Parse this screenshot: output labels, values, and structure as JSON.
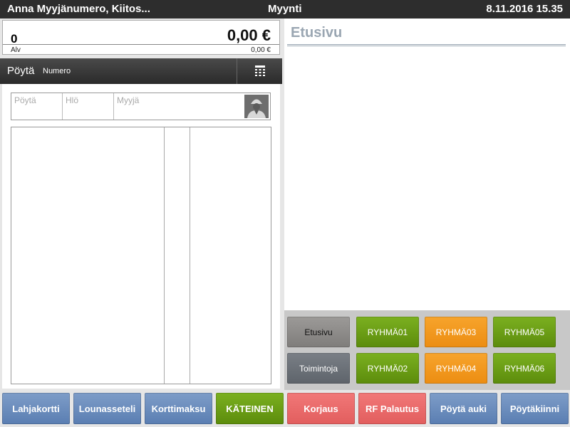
{
  "topbar": {
    "user": "Anna Myyjänumero, Kiitos...",
    "title": "Myynti",
    "datetime": "8.11.2016 15.35"
  },
  "total": {
    "count": "0",
    "amount": "0,00 €",
    "alv_label": "Alv",
    "alv_value": "0,00 €"
  },
  "table": {
    "label": "Pöytä",
    "number_placeholder": "Numero",
    "keypad_icon": "keypad-icon"
  },
  "info": {
    "table_placeholder": "Pöytä",
    "persons_placeholder": "Hlö",
    "seller_placeholder": "Myyjä",
    "avatar_icon": "person-icon"
  },
  "page": {
    "title": "Etusivu"
  },
  "groups": {
    "row1": [
      "Etusivu",
      "RYHMÄ01",
      "RYHMÄ03",
      "RYHMÄ05"
    ],
    "row2": [
      "Toimintoja",
      "RYHMÄ02",
      "RYHMÄ04",
      "RYHMÄ06"
    ]
  },
  "actions": [
    "Lahjakortti",
    "Lounasseteli",
    "Korttimaksu",
    "KÄTEINEN",
    "Korjaus",
    "RF Palautus",
    "Pöytä auki",
    "Pöytäkiinni"
  ],
  "colors": {
    "topbar": "#2d2d2d",
    "green": "#6a9c14",
    "orange": "#f39a1f",
    "blue": "#6b8cbe",
    "red": "#ea6868",
    "heading": "#9aa6b2"
  }
}
